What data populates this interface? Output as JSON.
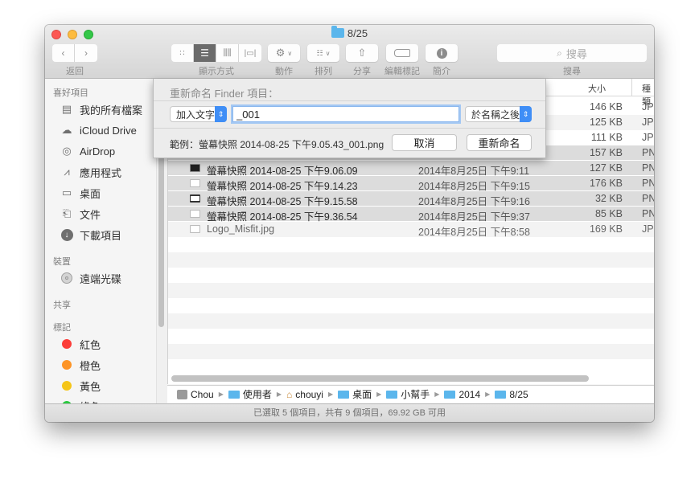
{
  "window": {
    "title": "8/25",
    "traffic_lights": [
      "close",
      "minimize",
      "zoom"
    ]
  },
  "toolbar": {
    "back_label": "返回",
    "view_label": "顯示方式",
    "action_label": "動作",
    "arrange_label": "排列",
    "share_label": "分享",
    "tags_label": "編輯標記",
    "info_label": "簡介",
    "search_label": "搜尋",
    "search_placeholder": "搜尋",
    "view_modes": [
      "icon",
      "list",
      "column",
      "cover-flow"
    ],
    "active_view": "list"
  },
  "sidebar": {
    "sections": [
      {
        "header": "喜好項目",
        "items": [
          {
            "label": "我的所有檔案",
            "icon": "all-files-icon"
          },
          {
            "label": "iCloud Drive",
            "icon": "cloud-icon"
          },
          {
            "label": "AirDrop",
            "icon": "airdrop-icon"
          },
          {
            "label": "應用程式",
            "icon": "applications-icon"
          },
          {
            "label": "桌面",
            "icon": "desktop-icon"
          },
          {
            "label": "文件",
            "icon": "documents-icon"
          },
          {
            "label": "下載項目",
            "icon": "downloads-icon"
          }
        ]
      },
      {
        "header": "裝置",
        "items": [
          {
            "label": "遠端光碟",
            "icon": "disc-icon"
          }
        ]
      },
      {
        "header": "共享",
        "items": []
      },
      {
        "header": "標記",
        "items": [
          {
            "label": "紅色",
            "color": "#fc3d39"
          },
          {
            "label": "橙色",
            "color": "#fd9426"
          },
          {
            "label": "黃色",
            "color": "#f5c518"
          },
          {
            "label": "綠色",
            "color": "#29c93e"
          }
        ]
      }
    ]
  },
  "file_list": {
    "columns": {
      "size": "大小",
      "kind": "種類"
    },
    "rows": [
      {
        "name": "",
        "date": "",
        "size": "146 KB",
        "kind": "JP",
        "selected": false
      },
      {
        "name": "",
        "date": "",
        "size": "125 KB",
        "kind": "JP",
        "selected": false
      },
      {
        "name": "",
        "date": "",
        "size": "111 KB",
        "kind": "JP",
        "selected": false
      },
      {
        "name": "",
        "date": "",
        "size": "157 KB",
        "kind": "PN",
        "selected": true
      },
      {
        "name": "螢幕快照 2014-08-25 下午9.06.09",
        "date": "2014年8月25日 下午9:11",
        "size": "127 KB",
        "kind": "PN",
        "selected": true
      },
      {
        "name": "螢幕快照 2014-08-25 下午9.14.23",
        "date": "2014年8月25日 下午9:15",
        "size": "176 KB",
        "kind": "PN",
        "selected": true
      },
      {
        "name": "螢幕快照 2014-08-25 下午9.15.58",
        "date": "2014年8月25日 下午9:16",
        "size": "32 KB",
        "kind": "PN",
        "selected": true
      },
      {
        "name": "螢幕快照 2014-08-25 下午9.36.54",
        "date": "2014年8月25日 下午9:37",
        "size": "85 KB",
        "kind": "PN",
        "selected": true
      },
      {
        "name": "Logo_Misfit.jpg",
        "date": "2014年8月25日 下午8:58",
        "size": "169 KB",
        "kind": "JP",
        "selected": false
      }
    ]
  },
  "path_bar": [
    {
      "label": "Chou",
      "icon": "hard-drive-icon"
    },
    {
      "label": "使用者",
      "icon": "users-folder-icon"
    },
    {
      "label": "chouyi",
      "icon": "home-icon"
    },
    {
      "label": "桌面",
      "icon": "desktop-folder-icon"
    },
    {
      "label": "小幫手",
      "icon": "folder-icon"
    },
    {
      "label": "2014",
      "icon": "folder-icon"
    },
    {
      "label": "8/25",
      "icon": "folder-icon"
    }
  ],
  "status_bar": "已選取 5 個項目，共有 9 個項目，69.92 GB 可用",
  "rename_sheet": {
    "title": "重新命名 Finder 項目：",
    "mode_popup": "加入文字",
    "text_value": "_001",
    "position_popup": "於名稱之後",
    "example": "範例：螢幕快照 2014-08-25 下午9.05.43_001.png",
    "cancel_label": "取消",
    "rename_label": "重新命名",
    "accent_color": "#3f8ef6"
  }
}
